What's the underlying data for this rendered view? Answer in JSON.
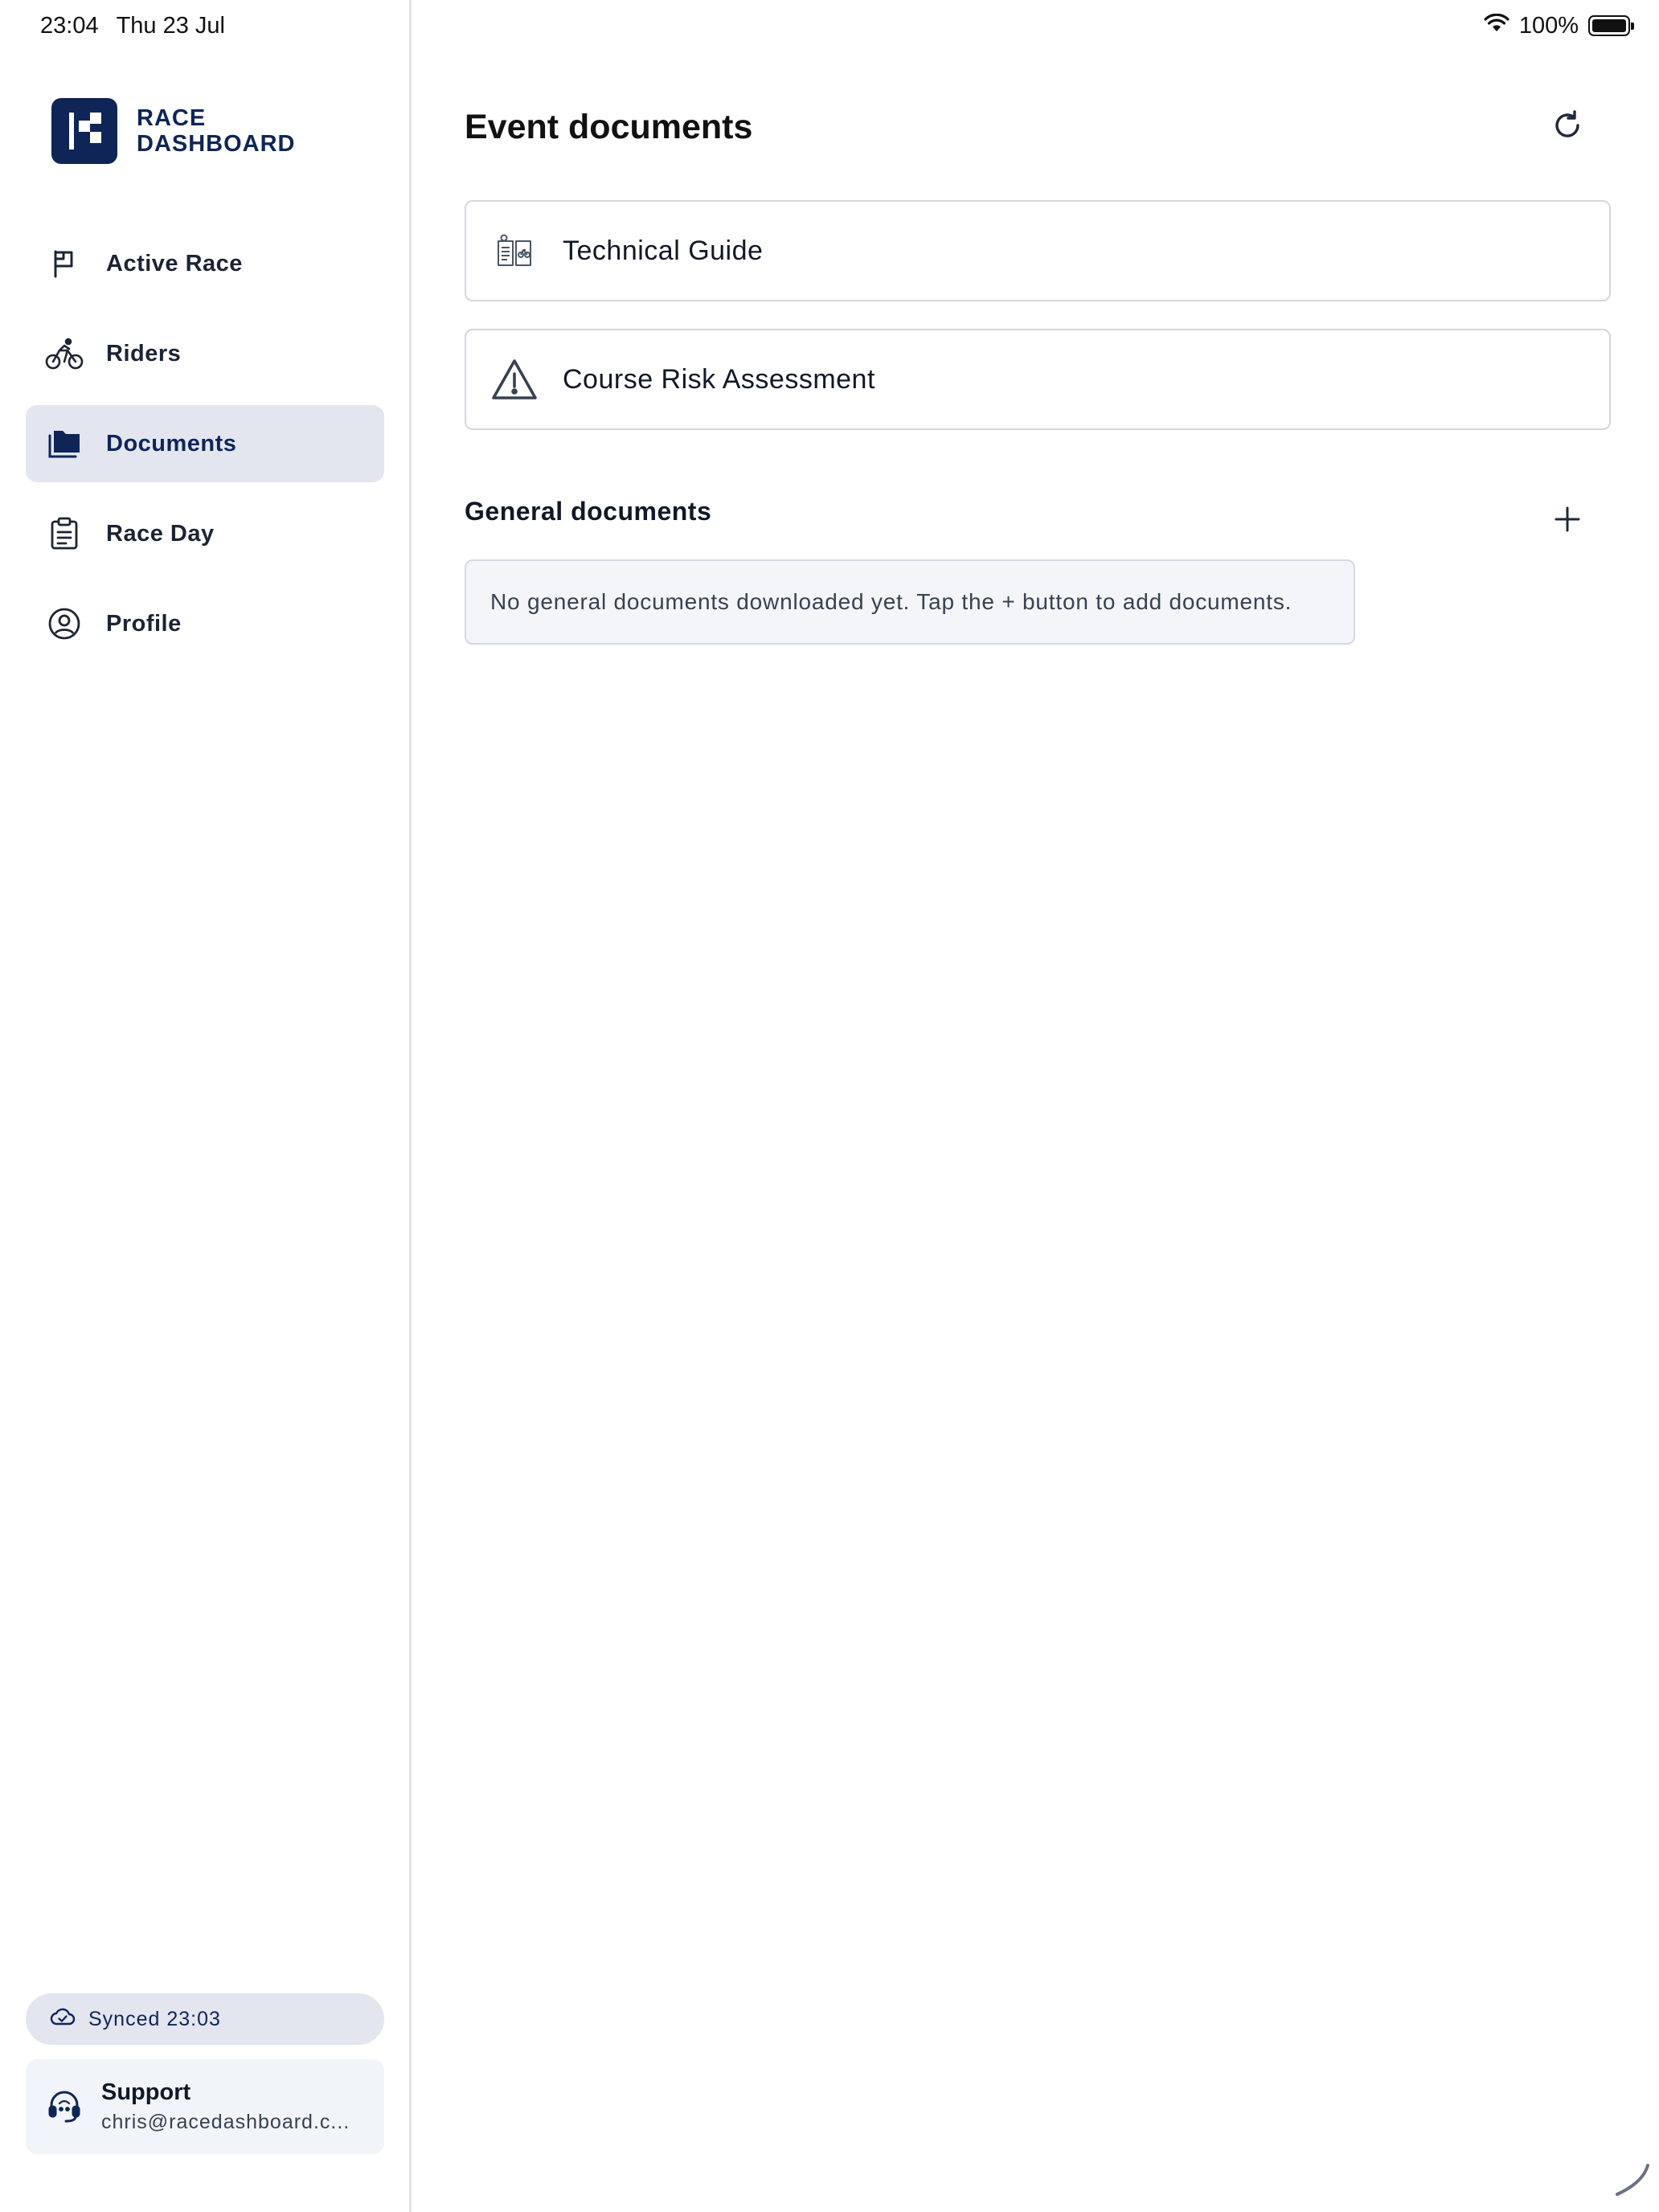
{
  "status_bar": {
    "time": "23:04",
    "date": "Thu 23 Jul",
    "battery": "100%",
    "wifi_icon": "wifi-icon",
    "battery_icon": "battery-icon"
  },
  "brand": {
    "line1": "RACE",
    "line2": "DASHBOARD",
    "color": "#0f2558"
  },
  "sidebar": {
    "items": [
      {
        "label": "Active Race",
        "icon": "flag-icon",
        "active": false
      },
      {
        "label": "Riders",
        "icon": "bicycle-rider-icon",
        "active": false
      },
      {
        "label": "Documents",
        "icon": "folder-icon",
        "active": true
      },
      {
        "label": "Race Day",
        "icon": "clipboard-icon",
        "active": false
      },
      {
        "label": "Profile",
        "icon": "user-circle-icon",
        "active": false
      }
    ],
    "sync_status": "Synced 23:03",
    "support": {
      "title": "Support",
      "email": "chris@racedashboard.c..."
    }
  },
  "main": {
    "title": "Event documents",
    "event_documents": [
      {
        "label": "Technical Guide",
        "icon": "technical-guide-icon"
      },
      {
        "label": "Course Risk Assessment",
        "icon": "warning-triangle-icon"
      }
    ],
    "general_title": "General documents",
    "general_empty": "No general documents downloaded yet. Tap the + button to add documents."
  }
}
